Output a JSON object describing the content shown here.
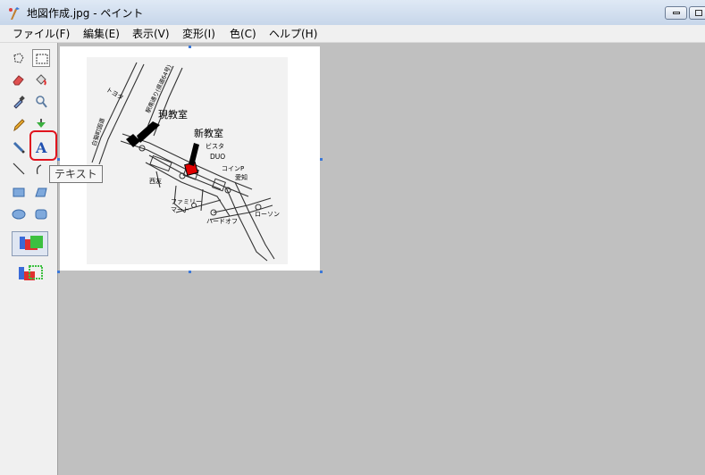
{
  "window": {
    "title": "地図作成.jpg - ペイント",
    "minimize_label": "minimize",
    "maximize_label": "maximize"
  },
  "menu": {
    "items": [
      {
        "label": "ファイル(F)"
      },
      {
        "label": "編集(E)"
      },
      {
        "label": "表示(V)"
      },
      {
        "label": "変形(I)"
      },
      {
        "label": "色(C)"
      },
      {
        "label": "ヘルプ(H)"
      }
    ]
  },
  "toolbox": {
    "tools": [
      {
        "name": "free-form-select"
      },
      {
        "name": "rectangle-select",
        "selected": true
      },
      {
        "name": "eraser"
      },
      {
        "name": "fill"
      },
      {
        "name": "pick-color"
      },
      {
        "name": "magnifier"
      },
      {
        "name": "pencil"
      },
      {
        "name": "brush"
      },
      {
        "name": "airbrush"
      },
      {
        "name": "text",
        "highlighted": true
      },
      {
        "name": "line"
      },
      {
        "name": "curve"
      },
      {
        "name": "rectangle"
      },
      {
        "name": "polygon"
      },
      {
        "name": "ellipse"
      },
      {
        "name": "rounded-rectangle"
      }
    ],
    "tooltip": "テキスト"
  },
  "map": {
    "labels": {
      "toyota": "トヨタ",
      "road_right": "駅南通り(県道64号)",
      "road_left": "白菊町国道",
      "current_room": "現教室",
      "new_room": "新教室",
      "vista": "ビスタ",
      "duo": "DUO",
      "coin_p": "コインP",
      "aichi": "愛知",
      "saiyu": "西友",
      "family_mart": "ファミリーマート",
      "family_mart_line1": "ファミリー",
      "family_mart_line2": "マート",
      "hard_off": "ハードオフ",
      "lawson": "ローソン"
    }
  },
  "colors": {
    "canvas_bg": "#c0c0c0",
    "toolbox_bg": "#f0f0f0",
    "highlight": "#e0141e",
    "new_room_marker": "#e00000",
    "selection_handle": "#3b78d8"
  }
}
